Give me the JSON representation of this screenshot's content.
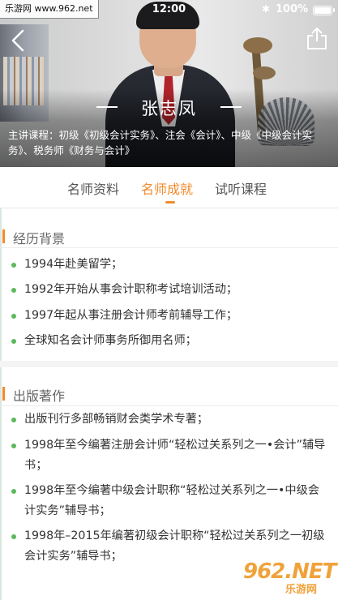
{
  "watermark_top": "乐游网 www.962.net",
  "status": {
    "time": "12:00",
    "battery": "100%"
  },
  "hero": {
    "name": "张志凤",
    "description": "主讲课程：初级《初级会计实务》、注会《会计》、中级《中级会计实务》、税务师《财务与会计》"
  },
  "tabs": [
    {
      "label": "名师资料"
    },
    {
      "label": "名师成就"
    },
    {
      "label": "试听课程"
    }
  ],
  "active_tab_index": 1,
  "sections": [
    {
      "title": "经历背景",
      "items": [
        "1994年赴美留学；",
        "1992年开始从事会计职称考试培训活动；",
        "1997年起从事注册会计师考前辅导工作；",
        "全球知名会计师事务所御用名师；"
      ]
    },
    {
      "title": "出版著作",
      "items": [
        "出版刊行多部畅销财会类学术专著；",
        "1998年至今编著注册会计师“轻松过关系列之一•会计”辅导书；",
        "1998年至今编著中级会计职称“轻松过关系列之一•中级会计实务”辅导书；",
        "1998年–2015年编著初级会计职称“轻松过关系列之一初级会计实务”辅导书；"
      ]
    }
  ],
  "watermark_bottom": {
    "logo": "962.NET",
    "text": "乐游网"
  },
  "colors": {
    "accent": "#f18b2d",
    "bullet": "#5cb85c"
  }
}
